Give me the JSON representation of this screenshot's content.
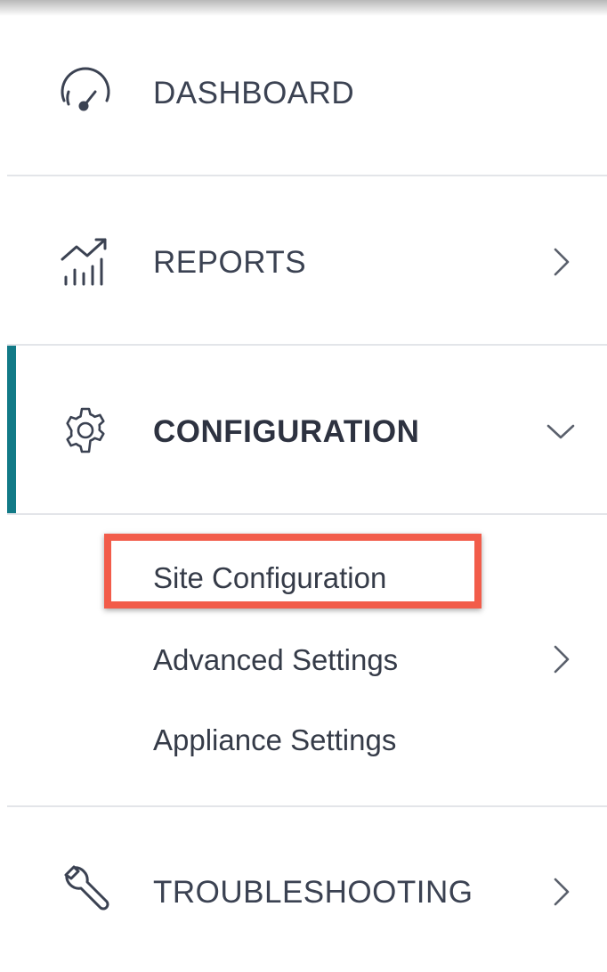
{
  "menu": {
    "dashboard": {
      "label": "DASHBOARD",
      "icon": "speedometer-icon"
    },
    "reports": {
      "label": "REPORTS",
      "icon": "chart-trend-icon",
      "chevron": "chevron-right-icon"
    },
    "configuration": {
      "label": "CONFIGURATION",
      "icon": "gear-icon",
      "chevron": "chevron-down-icon",
      "active": true,
      "children": [
        {
          "label": "Site Configuration",
          "highlighted": true
        },
        {
          "label": "Advanced Settings",
          "chevron": "chevron-right-icon"
        },
        {
          "label": "Appliance Settings"
        }
      ]
    },
    "troubleshooting": {
      "label": "TROUBLESHOOTING",
      "icon": "wrench-icon",
      "chevron": "chevron-right-icon"
    }
  },
  "colors": {
    "active_accent": "#127a87",
    "highlight_border": "#f25c4a",
    "text": "#3b4252",
    "divider": "#e3e5e9"
  }
}
